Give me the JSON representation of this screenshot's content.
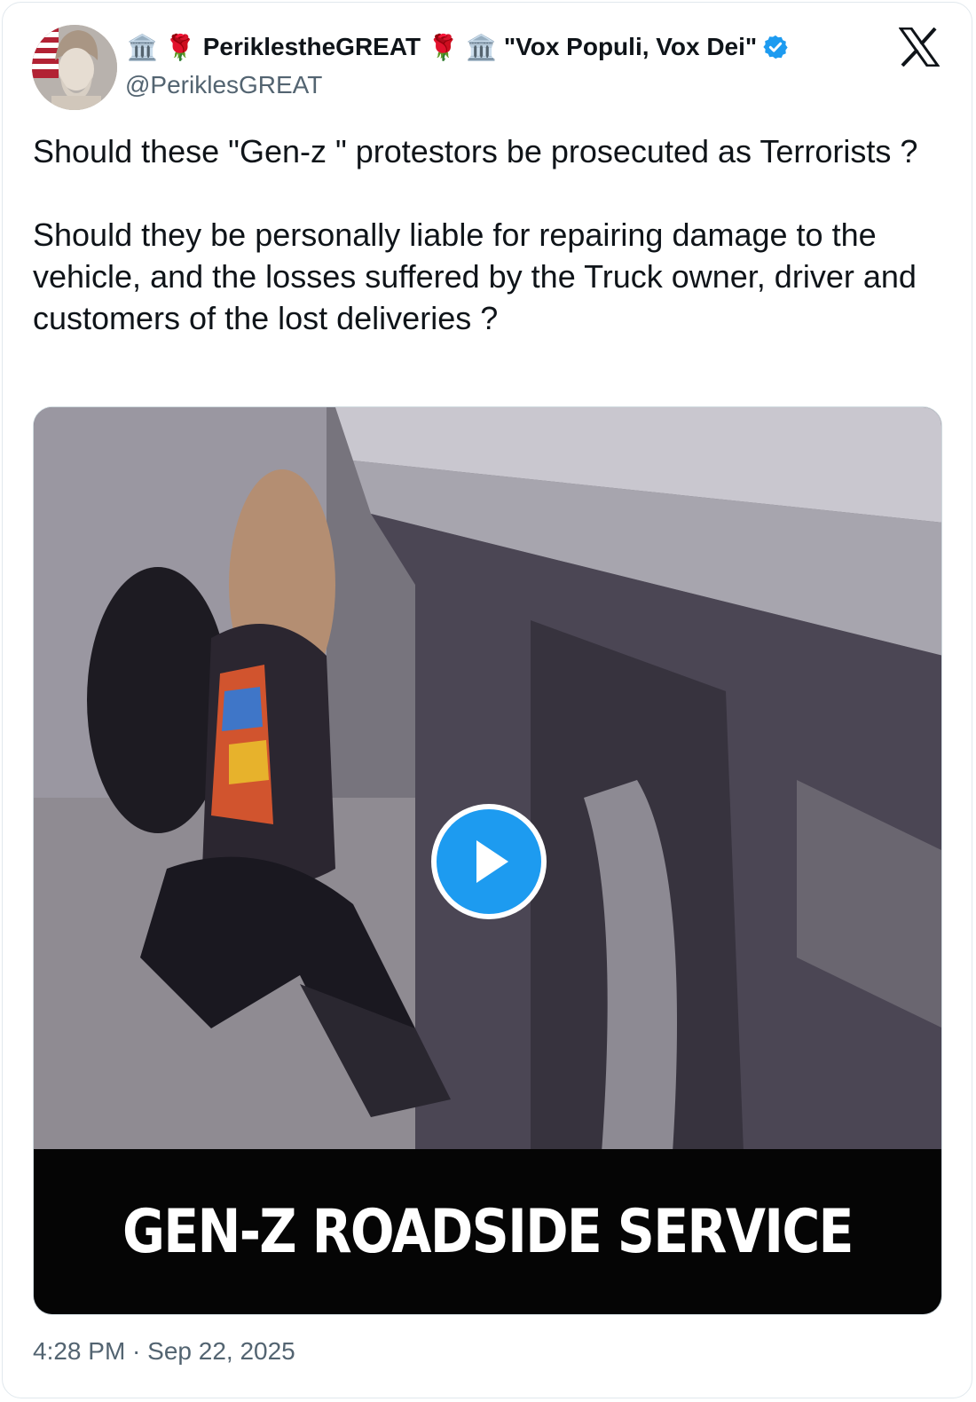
{
  "author": {
    "display_name_parts": [
      "🏛️",
      "🌹",
      "PeriklestheGREAT",
      "🌹",
      "🏛️",
      "\"Vox Populi, Vox Dei\""
    ],
    "handle": "@PeriklesGREAT",
    "verified_icon": "verified-badge-icon",
    "avatar_icon": "pericles-bust-avatar"
  },
  "platform_logo": "x-logo-icon",
  "tweet": {
    "paragraph_1": "Should these \"Gen-z \" protestors be prosecuted as Terrorists ?",
    "paragraph_2": "Should they be personally liable for repairing damage to the vehicle, and the losses suffered by the Truck owner, driver and customers of the lost deliveries ?"
  },
  "media": {
    "type": "video",
    "caption": "GEN-Z ROADSIDE SERVICE",
    "play_icon": "play-icon"
  },
  "timestamp": "4:28 PM · Sep 22, 2025",
  "colors": {
    "accent": "#1d9bf0",
    "text_primary": "#0f1419",
    "text_secondary": "#536471"
  }
}
